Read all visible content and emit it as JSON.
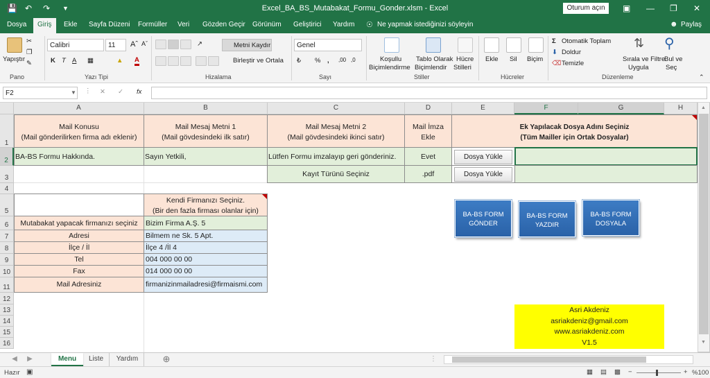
{
  "titlebar": {
    "title": "Excel_BA_BS_Mutabakat_Formu_Gonder.xlsm  -  Excel",
    "signin": "Oturum açın"
  },
  "tabs": [
    "Dosya",
    "Giriş",
    "Ekle",
    "Sayfa Düzeni",
    "Formüller",
    "Veri",
    "Gözden Geçir",
    "Görünüm",
    "Geliştirici",
    "Yardım"
  ],
  "search_placeholder": "Ne yapmak istediğinizi söyleyin",
  "share": "Paylaş",
  "ribbon": {
    "paste": "Yapıştır",
    "font_name": "Calibri",
    "font_size": "11",
    "wrap": "Metni Kaydır",
    "merge": "Birleştir ve Ortala",
    "number_format": "Genel",
    "cond_format": [
      "Koşullu",
      "Biçimlendirme"
    ],
    "table_format": [
      "Tablo Olarak",
      "Biçimlendir"
    ],
    "cell_styles": [
      "Hücre",
      "Stilleri"
    ],
    "insert": "Ekle",
    "delete": "Sil",
    "format": "Biçim",
    "autosum": "Otomatik Toplam",
    "fill": "Doldur",
    "clear": "Temizle",
    "sort": [
      "Sırala ve Filtre",
      "Uygula"
    ],
    "find": [
      "Bul ve",
      "Seç"
    ],
    "groups": [
      "Pano",
      "Yazı Tipi",
      "Hizalama",
      "Sayı",
      "Stiller",
      "Hücreler",
      "Düzenleme"
    ]
  },
  "namebox": "F2",
  "fx": "fx",
  "columns": [
    "A",
    "B",
    "C",
    "D",
    "E",
    "F",
    "G",
    "H"
  ],
  "rows": [
    "1",
    "2",
    "3",
    "4",
    "5",
    "6",
    "7",
    "8",
    "9",
    "10",
    "11",
    "12",
    "13",
    "14",
    "15",
    "16"
  ],
  "cells": {
    "a1_l1": "Mail Konusu",
    "a1_l2": "(Mail gönderilirken firma adı eklenir)",
    "b1_l1": "Mail Mesaj Metni 1",
    "b1_l2": "(Mail gövdesindeki ilk satır)",
    "c1_l1": "Mail Mesaj Metni 2",
    "c1_l2": "(Mail gövdesindeki ikinci satır)",
    "d1_l1": "Mail İmza",
    "d1_l2": "Ekle",
    "ef1_l1": "Ek Yapılacak Dosya Adını Seçiniz",
    "ef1_l2": "(Tüm Mailler için Ortak Dosyalar)",
    "a2": "BA-BS Formu Hakkında.",
    "b2": "Sayın Yetkili,",
    "c2": "Lütfen Formu imzalayıp geri gönderiniz.",
    "d2": "Evet",
    "c3": "Kayıt Türünü Seçiniz",
    "d3": ".pdf",
    "b5_l1": "Kendi Firmanızı Seçiniz.",
    "b5_l2": "(Bir den fazla firması olanlar için)",
    "a6": "Mutabakat yapacak firmanızı seçiniz",
    "b6": "Bizim Firma A.Ş. 5",
    "a7": "Adresi",
    "b7": "Bilmem ne Sk. 5 Apt.",
    "a8": "İlçe / İl",
    "b8": "İlçe 4 /İl 4",
    "a9": "Tel",
    "b9": "004 000 00 00",
    "a10": "Fax",
    "b10": "014 000 00 00",
    "a11": "Mail Adresiniz",
    "b11": "firmanizinmailadresi@firmaismi.com",
    "author": [
      "Asri Akdeniz",
      "asriakdeniz@gmail.com",
      "www.asriakdeniz.com",
      "V1.5"
    ]
  },
  "buttons": {
    "upload1": "Dosya Yükle",
    "upload2": "Dosya Yükle",
    "send": [
      "BA-BS FORM",
      "GÖNDER"
    ],
    "print": [
      "BA-BS FORM",
      "YAZDIR"
    ],
    "file": [
      "BA-BS FORM",
      "DOSYALA"
    ]
  },
  "sheets": [
    "Menu",
    "Liste",
    "Yardım"
  ],
  "status": {
    "ready": "Hazır",
    "zoom": "%100"
  },
  "colors": {
    "excel_green": "#217346",
    "peach": "#fce4d6",
    "light_green": "#e2efda",
    "light_blue": "#ddebf7",
    "yellow": "#ffff00",
    "button_blue": "#2e6bb3"
  }
}
